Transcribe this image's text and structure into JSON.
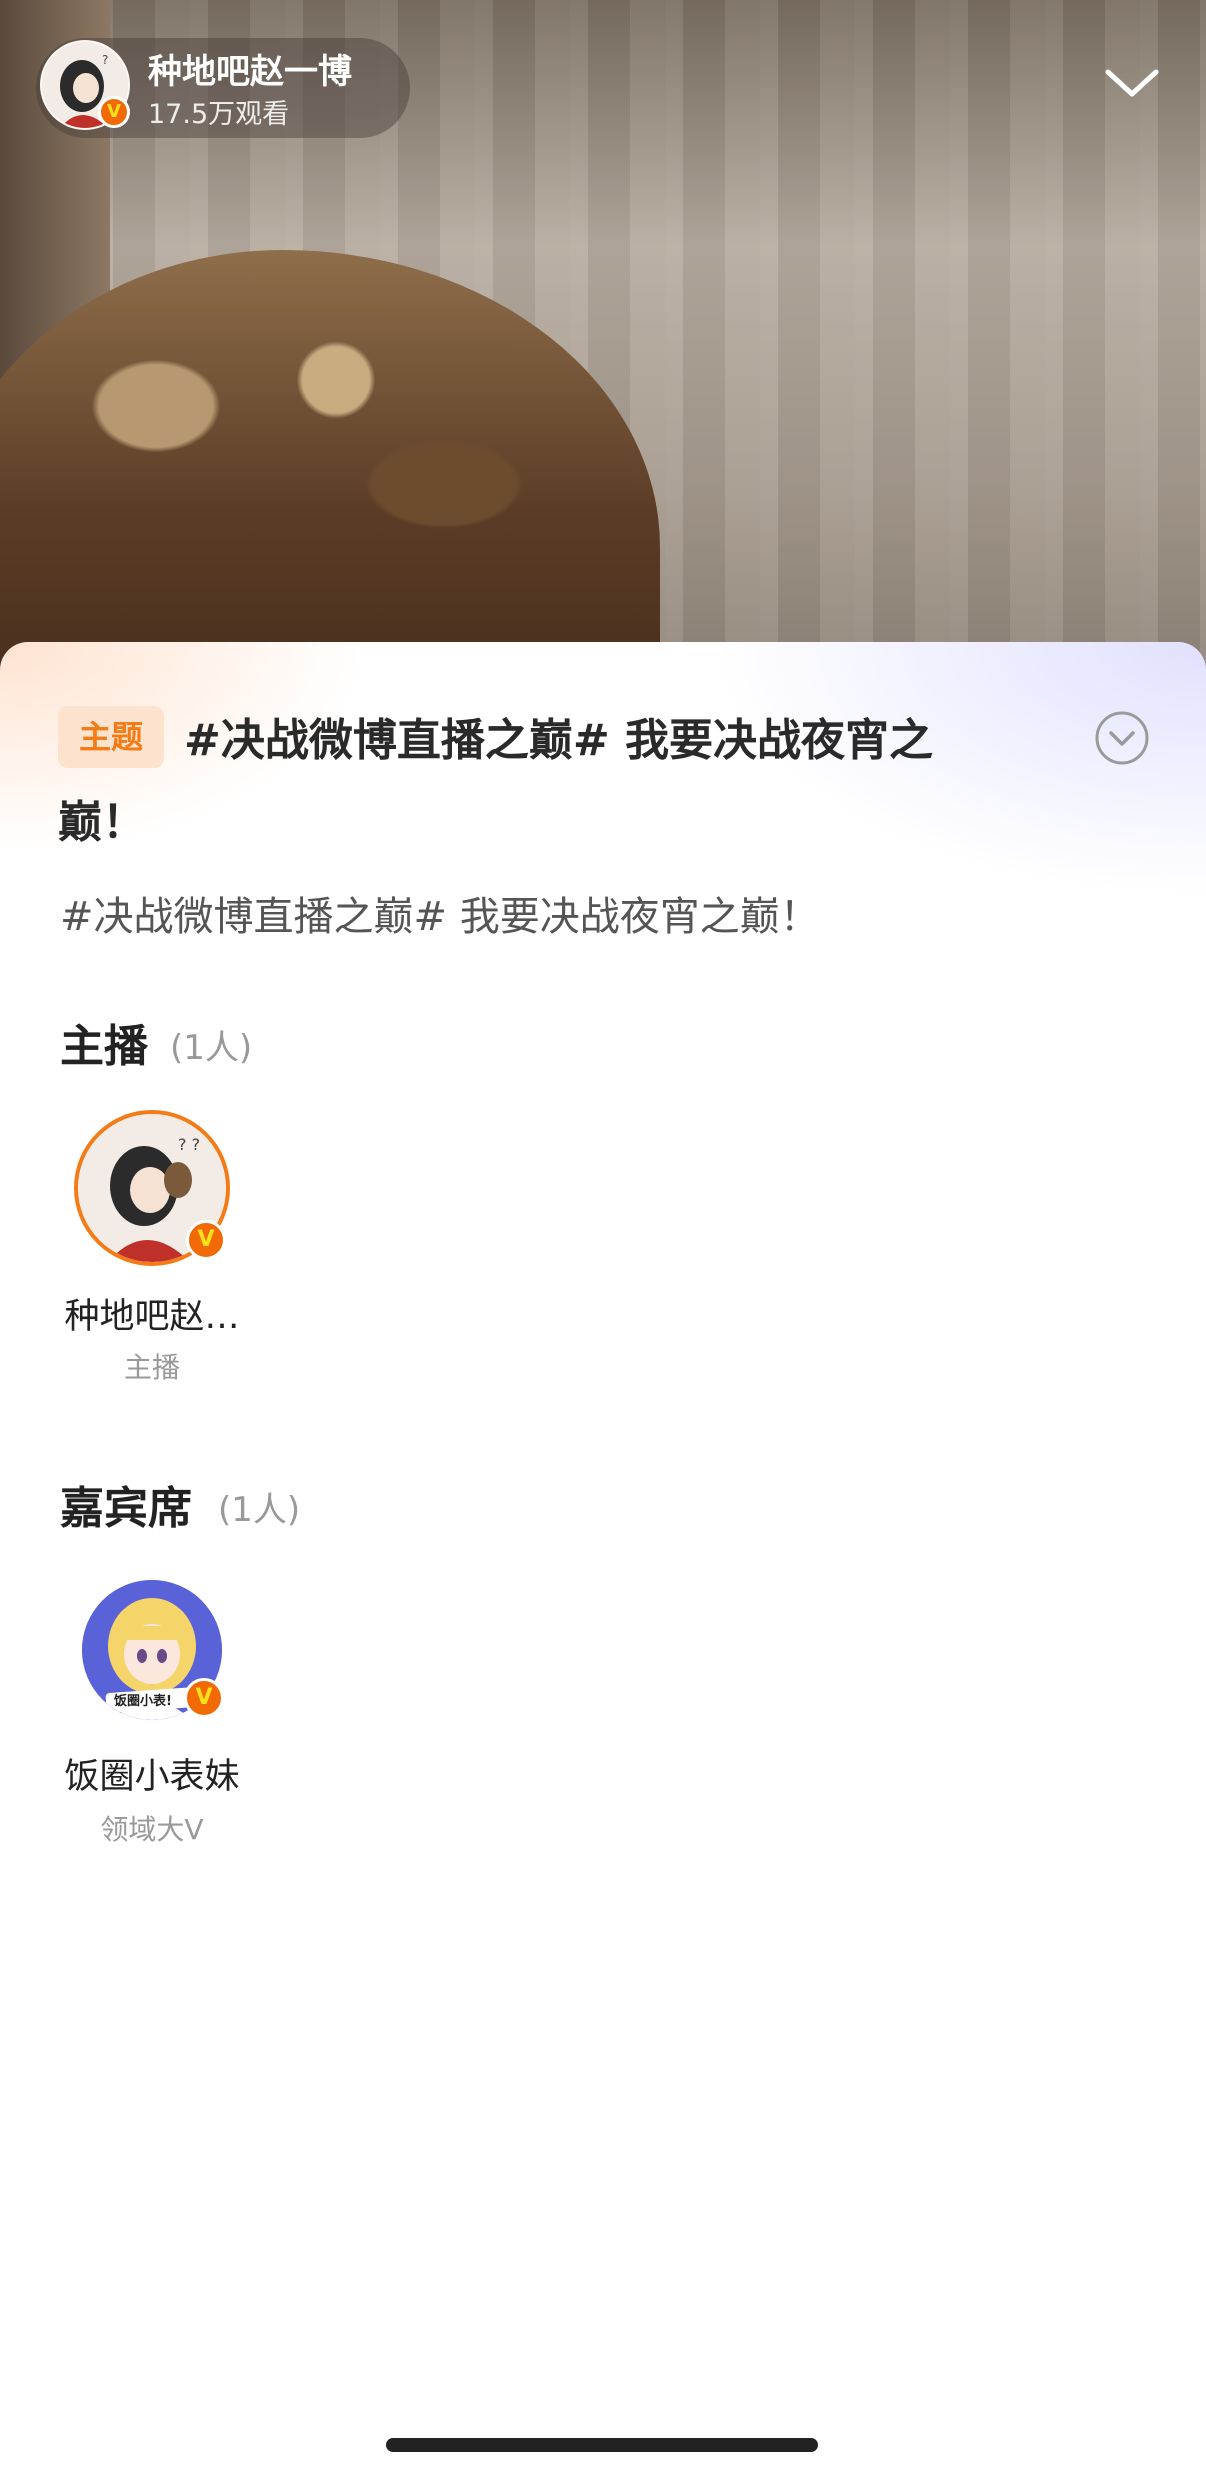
{
  "header": {
    "host_name": "种地吧赵一博",
    "viewers": "17.5万观看",
    "verified_mark": "V"
  },
  "topic": {
    "tag": "主题",
    "title_line1": "#决战微博直播之巅# 我要决战夜宵之",
    "title_line2": "巅！",
    "description": "#决战微博直播之巅# 我要决战夜宵之巅！"
  },
  "anchors": {
    "title": "主播",
    "count": "(1人)",
    "people": [
      {
        "name": "种地吧赵…",
        "role": "主播",
        "badge": "V"
      }
    ]
  },
  "guests": {
    "title": "嘉宾席",
    "count": "(1人)",
    "people": [
      {
        "name": "饭圈小表妹",
        "role": "领域大V",
        "badge": "V",
        "avatar_text": "饭圈小表!"
      }
    ]
  },
  "icons": {
    "collapse": "chevron-down-icon",
    "expand": "chevron-down-circle-icon"
  },
  "colors": {
    "accent_orange": "#f47b16",
    "tag_bg": "#fde3cd",
    "verified_orange": "#f26a05",
    "text_secondary": "#999999"
  }
}
